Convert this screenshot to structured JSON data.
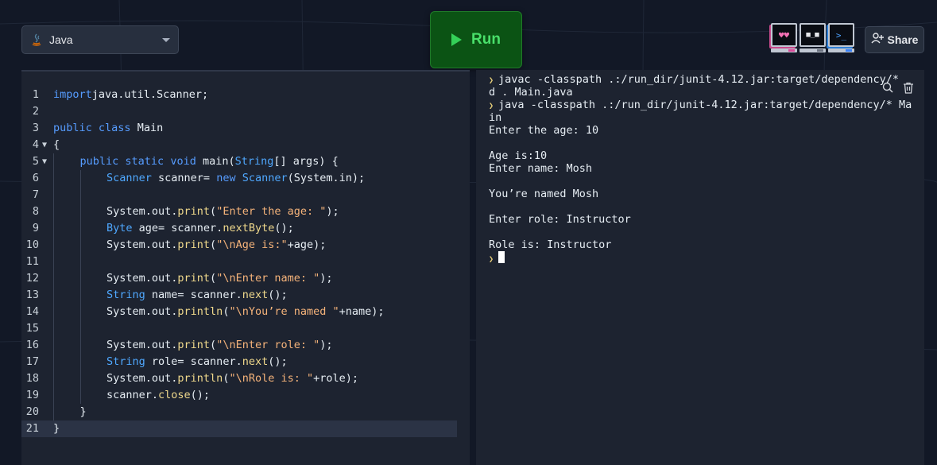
{
  "language_selector": {
    "label": "Java",
    "icon": "java-icon"
  },
  "run_button": {
    "label": "Run",
    "icon": "play-icon"
  },
  "avatars": [
    {
      "name": "heart-eyes-avatar",
      "face": "♥♥"
    },
    {
      "name": "neutral-avatar",
      "face": "■_■"
    },
    {
      "name": "prompt-avatar",
      "face": ">_"
    }
  ],
  "share_button": {
    "label": "Share",
    "icon": "add-user-icon"
  },
  "editor": {
    "active_line": 21,
    "lines": [
      {
        "n": "1",
        "fold": "",
        "indent": 0,
        "tokens": [
          [
            "kw",
            "import"
          ],
          [
            "",
            "java.util.Scanner;"
          ]
        ]
      },
      {
        "n": "2",
        "fold": "",
        "indent": 0,
        "tokens": []
      },
      {
        "n": "3",
        "fold": "",
        "indent": 0,
        "tokens": [
          [
            "kw",
            "public"
          ],
          [
            "",
            " "
          ],
          [
            "kw",
            "class"
          ],
          [
            "",
            " Main"
          ]
        ]
      },
      {
        "n": "4",
        "fold": "▼",
        "indent": 0,
        "tokens": [
          [
            "",
            "{"
          ]
        ]
      },
      {
        "n": "5",
        "fold": "▼",
        "indent": 1,
        "tokens": [
          [
            "kw",
            "public"
          ],
          [
            "",
            " "
          ],
          [
            "kw",
            "static"
          ],
          [
            "",
            " "
          ],
          [
            "kw",
            "void"
          ],
          [
            "",
            " main("
          ],
          [
            "ty",
            "String"
          ],
          [
            "",
            "[] args) {"
          ]
        ]
      },
      {
        "n": "6",
        "fold": "",
        "indent": 2,
        "tokens": [
          [
            "ty",
            "Scanner"
          ],
          [
            "",
            " scanner= "
          ],
          [
            "kw",
            "new"
          ],
          [
            "",
            " "
          ],
          [
            "ty",
            "Scanner"
          ],
          [
            "",
            "(System.in);"
          ]
        ]
      },
      {
        "n": "7",
        "fold": "",
        "indent": 2,
        "tokens": []
      },
      {
        "n": "8",
        "fold": "",
        "indent": 2,
        "tokens": [
          [
            "",
            "System.out."
          ],
          [
            "fn",
            "print"
          ],
          [
            "",
            "("
          ],
          [
            "st",
            "\"Enter the age: \""
          ],
          [
            "",
            ");"
          ]
        ]
      },
      {
        "n": "9",
        "fold": "",
        "indent": 2,
        "tokens": [
          [
            "ty",
            "Byte"
          ],
          [
            "",
            " age= scanner."
          ],
          [
            "fn",
            "nextByte"
          ],
          [
            "",
            "();"
          ]
        ]
      },
      {
        "n": "10",
        "fold": "",
        "indent": 2,
        "tokens": [
          [
            "",
            "System.out."
          ],
          [
            "fn",
            "print"
          ],
          [
            "",
            "("
          ],
          [
            "st",
            "\"\\nAge is:\""
          ],
          [
            "",
            "+age);"
          ]
        ]
      },
      {
        "n": "11",
        "fold": "",
        "indent": 2,
        "tokens": []
      },
      {
        "n": "12",
        "fold": "",
        "indent": 2,
        "tokens": [
          [
            "",
            "System.out."
          ],
          [
            "fn",
            "print"
          ],
          [
            "",
            "("
          ],
          [
            "st",
            "\"\\nEnter name: \""
          ],
          [
            "",
            ");"
          ]
        ]
      },
      {
        "n": "13",
        "fold": "",
        "indent": 2,
        "tokens": [
          [
            "ty",
            "String"
          ],
          [
            "",
            " name= scanner."
          ],
          [
            "fn",
            "next"
          ],
          [
            "",
            "();"
          ]
        ]
      },
      {
        "n": "14",
        "fold": "",
        "indent": 2,
        "tokens": [
          [
            "",
            "System.out."
          ],
          [
            "fn",
            "println"
          ],
          [
            "",
            "("
          ],
          [
            "st",
            "\"\\nYou’re named \""
          ],
          [
            "",
            "+name);"
          ]
        ]
      },
      {
        "n": "15",
        "fold": "",
        "indent": 2,
        "tokens": []
      },
      {
        "n": "16",
        "fold": "",
        "indent": 2,
        "tokens": [
          [
            "",
            "System.out."
          ],
          [
            "fn",
            "print"
          ],
          [
            "",
            "("
          ],
          [
            "st",
            "\"\\nEnter role: \""
          ],
          [
            "",
            ");"
          ]
        ]
      },
      {
        "n": "17",
        "fold": "",
        "indent": 2,
        "tokens": [
          [
            "ty",
            "String"
          ],
          [
            "",
            " role= scanner."
          ],
          [
            "fn",
            "next"
          ],
          [
            "",
            "();"
          ]
        ]
      },
      {
        "n": "18",
        "fold": "",
        "indent": 2,
        "tokens": [
          [
            "",
            "System.out."
          ],
          [
            "fn",
            "println"
          ],
          [
            "",
            "("
          ],
          [
            "st",
            "\"\\nRole is: \""
          ],
          [
            "",
            "+role);"
          ]
        ]
      },
      {
        "n": "19",
        "fold": "",
        "indent": 2,
        "tokens": [
          [
            "",
            "scanner."
          ],
          [
            "fn",
            "close"
          ],
          [
            "",
            "();"
          ]
        ]
      },
      {
        "n": "20",
        "fold": "",
        "indent": 1,
        "tokens": [
          [
            "",
            "}"
          ]
        ]
      },
      {
        "n": "21",
        "fold": "",
        "indent": 0,
        "tokens": [
          [
            "",
            "}"
          ]
        ]
      }
    ]
  },
  "terminal": {
    "actions": [
      {
        "name": "search-icon",
        "label": "search"
      },
      {
        "name": "trash-icon",
        "label": "clear"
      }
    ],
    "lines": [
      {
        "prompt": true,
        "text": "javac -classpath .:/run_dir/junit-4.12.jar:target/dependency/*"
      },
      {
        "prompt": false,
        "text": "d . Main.java"
      },
      {
        "prompt": true,
        "text": "java -classpath .:/run_dir/junit-4.12.jar:target/dependency/* Ma"
      },
      {
        "prompt": false,
        "text": "in"
      },
      {
        "prompt": false,
        "text": "Enter the age: 10"
      },
      {
        "prompt": false,
        "text": ""
      },
      {
        "prompt": false,
        "text": "Age is:10"
      },
      {
        "prompt": false,
        "text": "Enter name: Mosh"
      },
      {
        "prompt": false,
        "text": ""
      },
      {
        "prompt": false,
        "text": "You’re named Mosh"
      },
      {
        "prompt": false,
        "text": ""
      },
      {
        "prompt": false,
        "text": "Enter role: Instructor"
      },
      {
        "prompt": false,
        "text": ""
      },
      {
        "prompt": false,
        "text": "Role is: Instructor"
      },
      {
        "prompt": true,
        "text": "",
        "cursor": true
      }
    ]
  }
}
